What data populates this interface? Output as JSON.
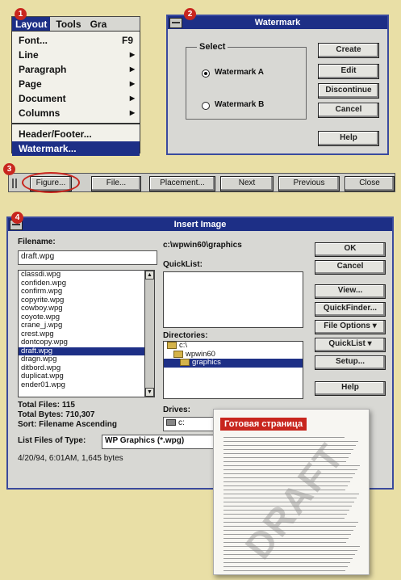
{
  "badges": [
    "1",
    "2",
    "3",
    "4"
  ],
  "menu": {
    "bar": [
      "Layout",
      "Tools",
      "Gra"
    ],
    "items": [
      {
        "label": "Font...",
        "shortcut": "F9"
      },
      {
        "label": "Line"
      },
      {
        "label": "Paragraph"
      },
      {
        "label": "Page"
      },
      {
        "label": "Document"
      },
      {
        "label": "Columns"
      },
      {
        "label": "Header/Footer..."
      },
      {
        "label": "Watermark..."
      }
    ]
  },
  "watermark": {
    "title": "Watermark",
    "group_label": "Select",
    "option_a": "Watermark A",
    "option_b": "Watermark B",
    "buttons": [
      "Create",
      "Edit",
      "Discontinue",
      "Cancel",
      "Help"
    ]
  },
  "toolbar": {
    "buttons": [
      "Figure...",
      "File...",
      "Placement...",
      "Next",
      "Previous",
      "Close"
    ]
  },
  "insert": {
    "title": "Insert Image",
    "filename_label": "Filename:",
    "filename_value": "draft.wpg",
    "path": "c:\\wpwin60\\graphics",
    "quicklist_label": "QuickList:",
    "directories_label": "Directories:",
    "dirs": [
      "c:\\",
      "wpwin60",
      "graphics"
    ],
    "drives_label": "Drives:",
    "drive_value": "c:",
    "files": [
      "classdi.wpg",
      "confiden.wpg",
      "confirm.wpg",
      "copyrite.wpg",
      "cowboy.wpg",
      "coyote.wpg",
      "crane_j.wpg",
      "crest.wpg",
      "dontcopy.wpg",
      "draft.wpg",
      "dragn.wpg",
      "ditbord.wpg",
      "duplicat.wpg",
      "ender01.wpg"
    ],
    "total_files": "Total Files:   115",
    "total_bytes": "Total Bytes:  710,307",
    "sort": "Sort:  Filename  Ascending",
    "list_type_label": "List Files of Type:",
    "list_type_value": "WP Graphics (*.wpg)",
    "file_info": "4/20/94,  6:01AM, 1,645 bytes",
    "buttons": [
      "OK",
      "Cancel",
      "View...",
      "QuickFinder...",
      "File Options ▾",
      "QuickList ▾",
      "Setup...",
      "Help"
    ]
  },
  "paper": {
    "title": "Готовая страница",
    "watermark_text": "DRAFT"
  },
  "colors": {
    "accent_red": "#c8261e",
    "title_blue": "#1d2f86",
    "background": "#e9dfa6"
  }
}
